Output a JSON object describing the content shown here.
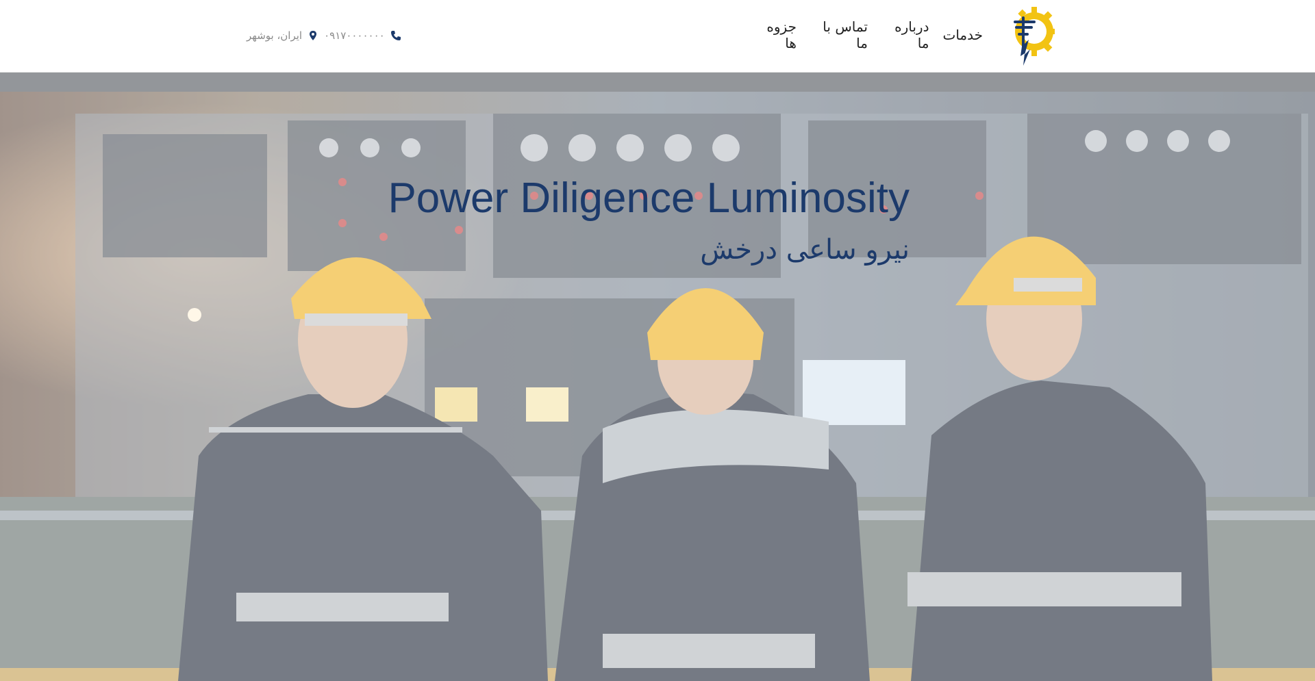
{
  "header": {
    "logo_icon": "power-tower-gear-icon",
    "nav": [
      {
        "label": "خدمات"
      },
      {
        "label": "درباره ما"
      },
      {
        "label": "تماس با ما"
      },
      {
        "label": "جزوه ها"
      }
    ],
    "contact": {
      "phone": "۰۹۱۷۰۰۰۰۰۰۰",
      "phone_icon": "phone-icon",
      "location": "ایران، بوشهر",
      "location_icon": "map-pin-icon"
    }
  },
  "hero": {
    "title": "Power Diligence Luminosity",
    "subtitle": "نیرو ساعی درخش"
  },
  "colors": {
    "accent_yellow": "#f2c313",
    "brand_navy": "#1c3a6b",
    "nav_text": "#1f1f1f",
    "muted_text": "#8a8a8a"
  }
}
